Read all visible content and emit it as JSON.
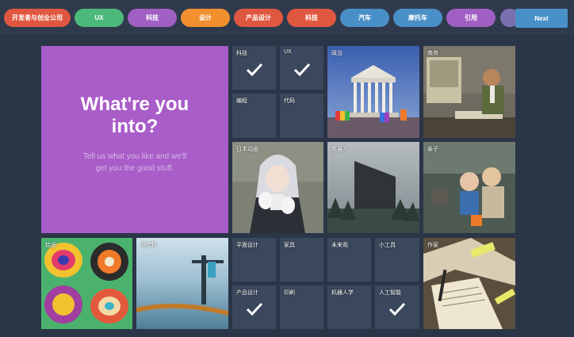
{
  "topics_bar": {
    "pills": [
      {
        "label": "开发者与创业公司",
        "color": "#e0573f"
      },
      {
        "label": "UX",
        "color": "#4cb87a"
      },
      {
        "label": "科技",
        "color": "#a05fc3"
      },
      {
        "label": "设计",
        "color": "#f2902f"
      },
      {
        "label": "产品设计",
        "color": "#e0573f"
      },
      {
        "label": "科技",
        "color": "#e0573f"
      },
      {
        "label": "汽车",
        "color": "#4a90c8"
      },
      {
        "label": "摩托车",
        "color": "#4a90c8"
      },
      {
        "label": "引用",
        "color": "#a05fc3"
      }
    ],
    "next_label": "Next"
  },
  "hero": {
    "title": "What're you into?",
    "subtitle": "Tell us what you like and we'll get you the good stuff."
  },
  "tiles": [
    {
      "label": "科技",
      "checked": true
    },
    {
      "label": "UX",
      "checked": true
    },
    {
      "label": "政治",
      "checked": false
    },
    {
      "label": "商务",
      "checked": false
    },
    {
      "label": "编程",
      "checked": false
    },
    {
      "label": "代码",
      "checked": false
    },
    {
      "label": "日本动画",
      "checked": false
    },
    {
      "label": "策展人",
      "checked": false
    },
    {
      "label": "亲子",
      "checked": false
    },
    {
      "label": "绘画",
      "checked": false
    },
    {
      "label": "非塑料",
      "checked": false
    },
    {
      "label": "平面设计",
      "checked": false
    },
    {
      "label": "家具",
      "checked": false
    },
    {
      "label": "未来观",
      "checked": false
    },
    {
      "label": "小工具",
      "checked": false
    },
    {
      "label": "作家",
      "checked": false
    },
    {
      "label": "产品设计",
      "checked": true
    },
    {
      "label": "印刷",
      "checked": false
    },
    {
      "label": "机器人学",
      "checked": false
    },
    {
      "label": "人工智能",
      "checked": true
    }
  ],
  "colors": {
    "background": "#2a3547",
    "hero": "#a95dc8",
    "tile": "#354258",
    "next_button": "#4a90c8"
  }
}
